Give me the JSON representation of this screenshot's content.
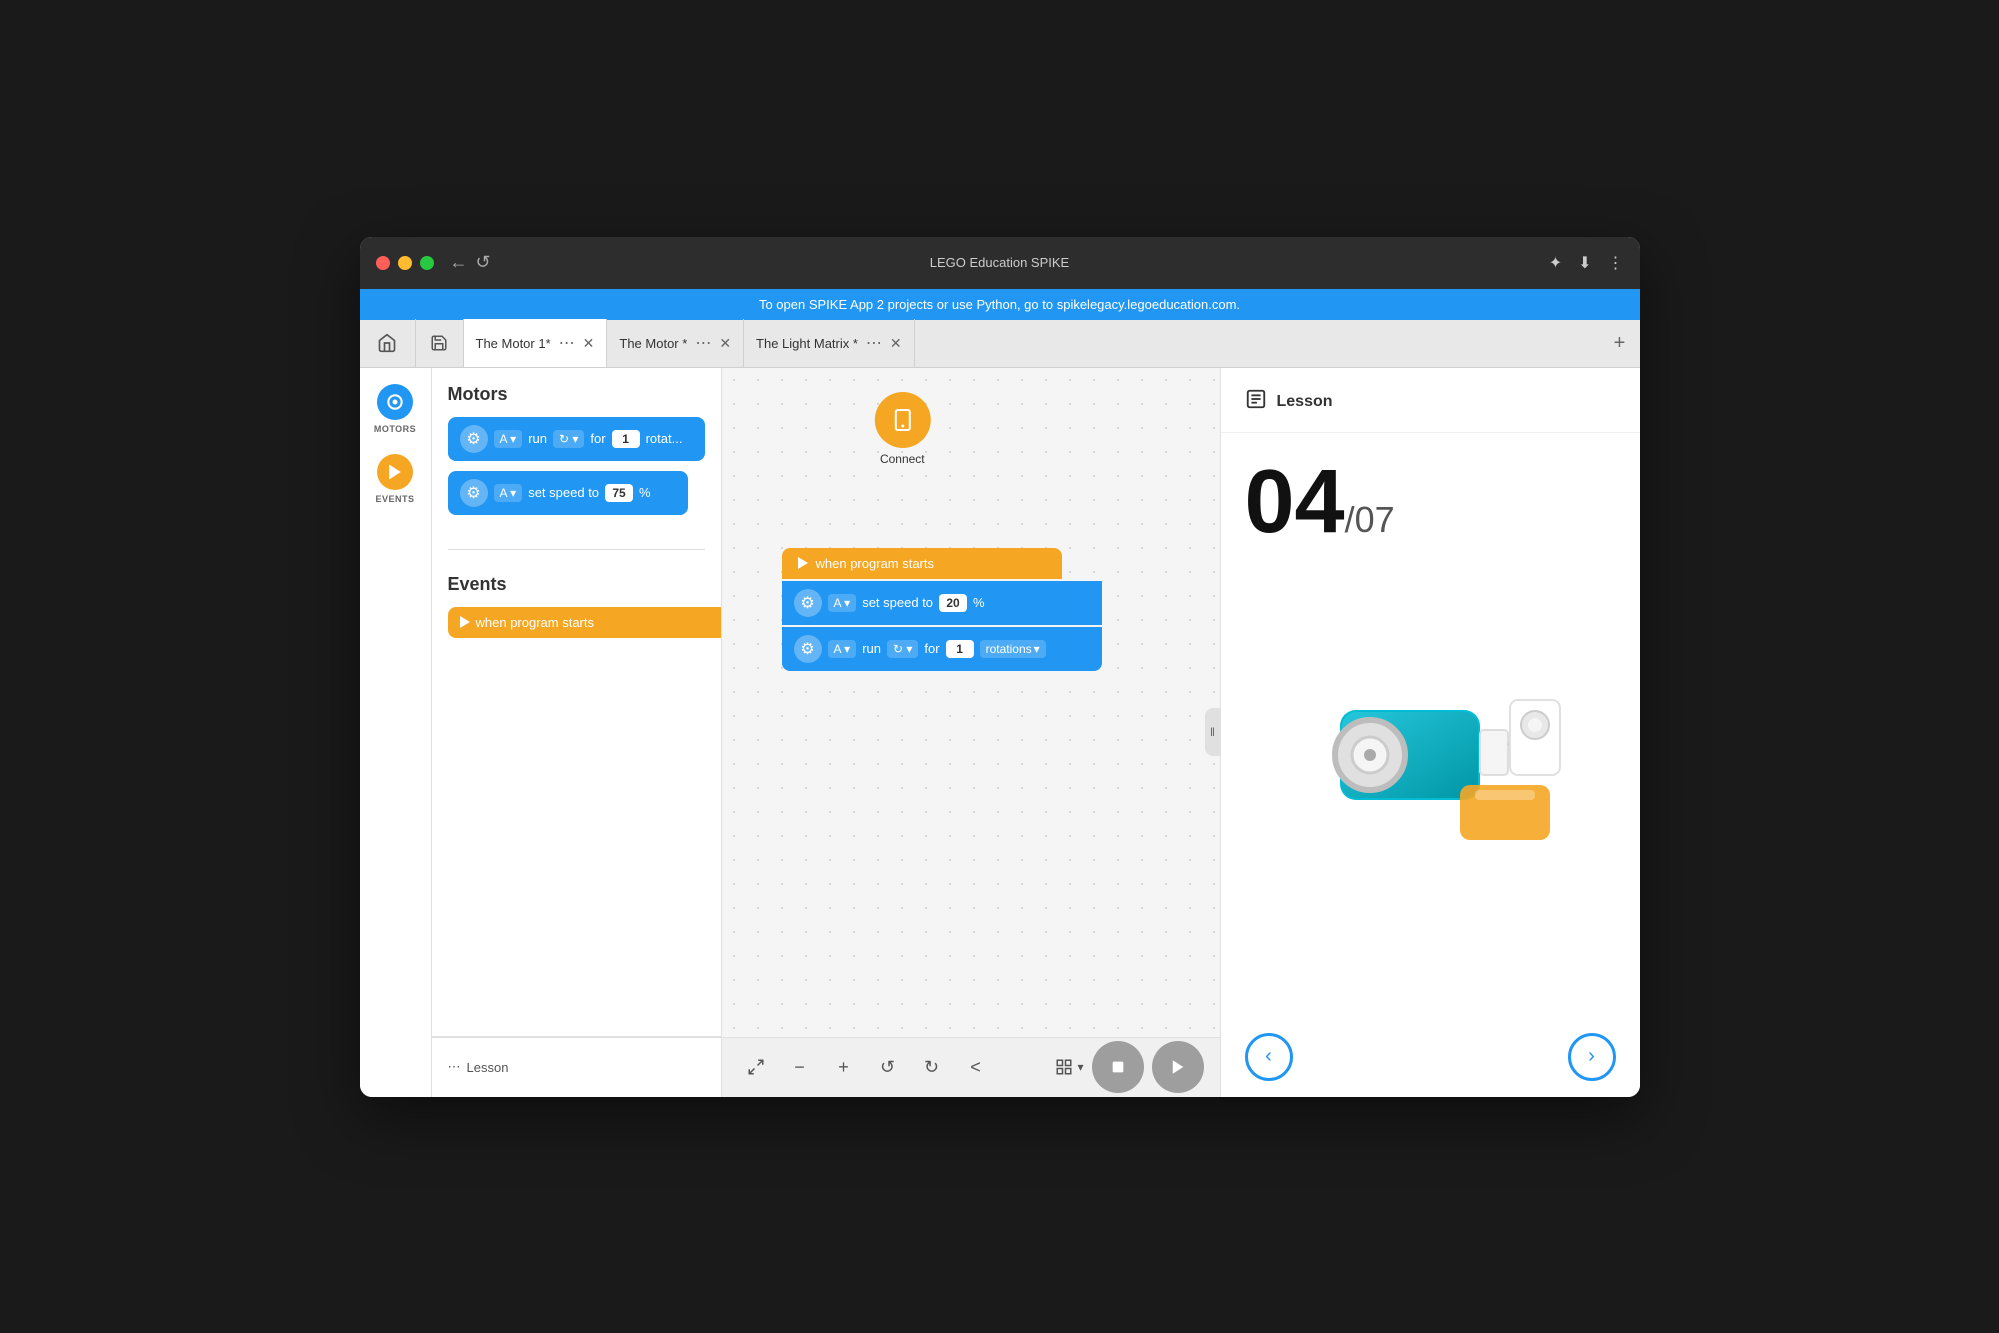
{
  "window": {
    "title": "LEGO Education SPIKE"
  },
  "banner": {
    "text": "To open SPIKE App 2 projects or use Python, go to spikelegacy.legoeducation.com."
  },
  "tabs": [
    {
      "label": "The Motor 1*",
      "active": true
    },
    {
      "label": "The Motor *",
      "active": false
    },
    {
      "label": "The Light Matrix *",
      "active": false
    }
  ],
  "sidebar": {
    "motors_label": "MOTORS",
    "events_label": "EVENTS"
  },
  "blocks_panel": {
    "motors_title": "Motors",
    "events_title": "Events",
    "run_block": {
      "port": "A",
      "action": "run",
      "value": "1",
      "unit": "rotat..."
    },
    "speed_block": {
      "port": "A",
      "action": "set speed to",
      "value": "75",
      "unit": "%"
    },
    "when_program_starts": "when program starts"
  },
  "canvas": {
    "connect_label": "Connect",
    "program_block": {
      "trigger": "when program starts",
      "set_speed": {
        "port": "A",
        "action": "set speed to",
        "value": "20",
        "unit": "%"
      },
      "run": {
        "port": "A",
        "action": "run",
        "value": "1",
        "unit": "rotations"
      }
    }
  },
  "lesson": {
    "title": "Lesson",
    "current": "04",
    "total": "/07",
    "prev_label": "‹",
    "next_label": "›"
  },
  "bottom_toolbar": {
    "lesson_label": "Lesson",
    "fit_icon": "⤢",
    "zoom_out_icon": "−",
    "zoom_in_icon": "+",
    "undo_icon": "↺",
    "redo_icon": "↻",
    "back_icon": "<",
    "grid_label": "⊞"
  }
}
